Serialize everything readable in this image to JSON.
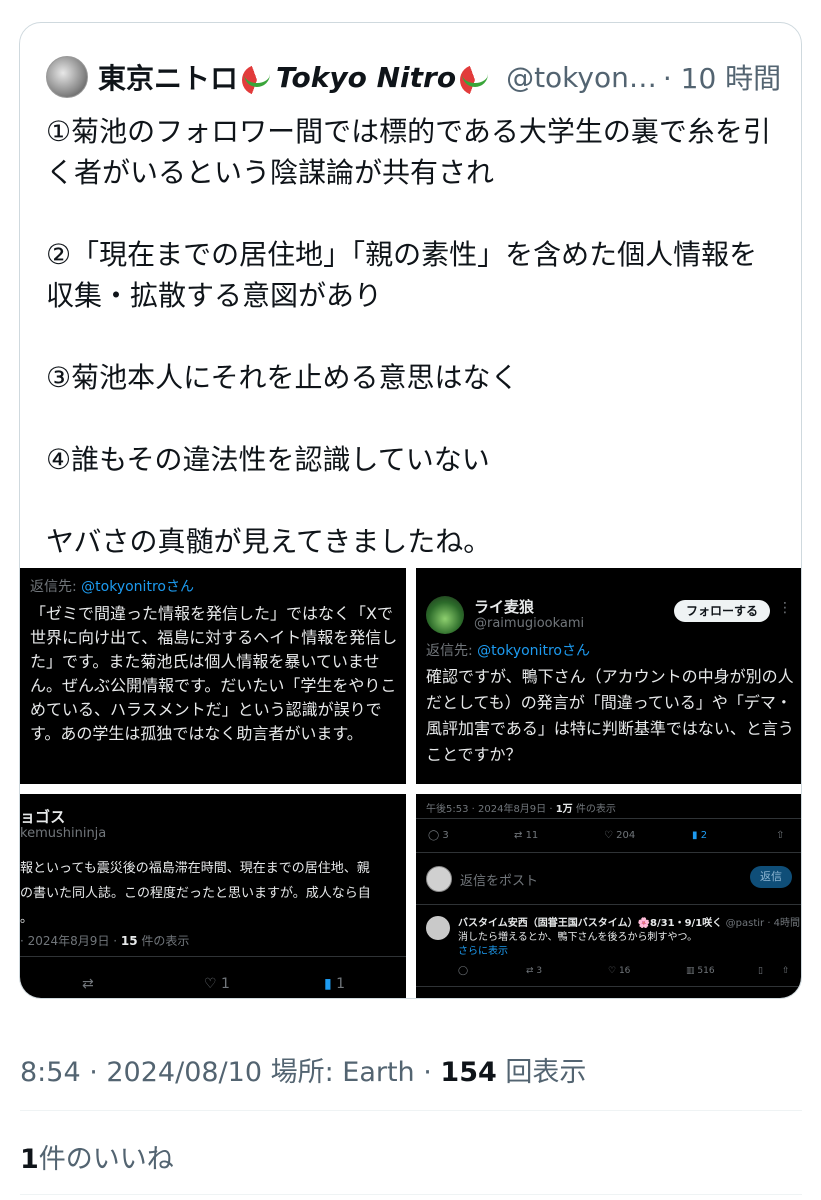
{
  "quote": {
    "name_jp": "東京ニトロ",
    "name_en": "Tokyo Nitro",
    "handle": "@tokyon…",
    "time": "· 10 時間",
    "icons": [
      "watermelon-emoji",
      "watermelon-emoji"
    ],
    "text": [
      "①菊池のフォロワー間では標的である大学生の裏で糸を引く者がいるという陰謀論が共有され",
      "②「現在までの居住地」「親の素性」を含めた個人情報を収集・拡散する意図があり",
      "③菊池本人にそれを止める意思はなく",
      "④誰もその違法性を認識していない",
      "ヤバさの真髄が見えてきましたね。"
    ]
  },
  "images": {
    "tile1": {
      "reply_to_prefix": "返信先: ",
      "reply_to_handle": "@tokyonitroさん",
      "body": "「ゼミで間違った情報を発信した」ではなく「Xで世界に向け出て、福島に対するヘイト情報を発信した」です。また菊池氏は個人情報を暴いていません。ぜんぶ公開情報です。だいたい「学生をやりこめている、ハラスメントだ」という認識が誤りです。あの学生は孤独ではなく助言者がいます。"
    },
    "tile2": {
      "name": "ライ麦狼",
      "handle": "@raimugiookami",
      "follow_label": "フォローする",
      "more": "⋮",
      "reply_to_prefix": "返信先: ",
      "reply_to_handle": "@tokyonitroさん",
      "body": "確認ですが、鴨下さん（アカウントの中身が別の人だとしても）の発言が「間違っている」や「デマ・風評加害である」は特に判断基準ではない、と言うことですか？"
    },
    "tile3": {
      "name": "ョゴス",
      "handle": "kemushininja",
      "body_lines": [
        "報といっても震災後の福島滞在時間、現在までの居住地、親",
        "の書いた同人誌。この程度だったと思いますが。成人なら自",
        "。"
      ],
      "date": "· 2024年8月9日 · ",
      "views": "15",
      "views_suffix": " 件の表示",
      "like_count": "1",
      "bookmark_count": "1"
    },
    "tile4": {
      "meta_prefix": "午後5:53 · 2024年8月9日 · ",
      "views": "1万",
      "views_suffix": " 件の表示",
      "reply_count": "3",
      "retweet_count": "11",
      "like_count": "204",
      "bookmark_count": "2",
      "reply_placeholder": "返信をポスト",
      "reply_button": "返信",
      "reply": {
        "name": "バスタイム安西（固甞王国バスタイム）🌸8/31・9/1咲く",
        "handle": "@pastir · 4時間",
        "body": "消したら増えるとか、鴨下さんを後ろから刺すやつ。",
        "more": "さらに表示",
        "reply_count": "",
        "retweet_count": "3",
        "like_count": "16",
        "view_count": "516"
      }
    }
  },
  "footer": {
    "time": "8:54 · 2024/08/10 場所: Earth · ",
    "views": "154",
    "views_suffix": " 回表示",
    "likes": "1",
    "likes_suffix": "件のいいね"
  }
}
